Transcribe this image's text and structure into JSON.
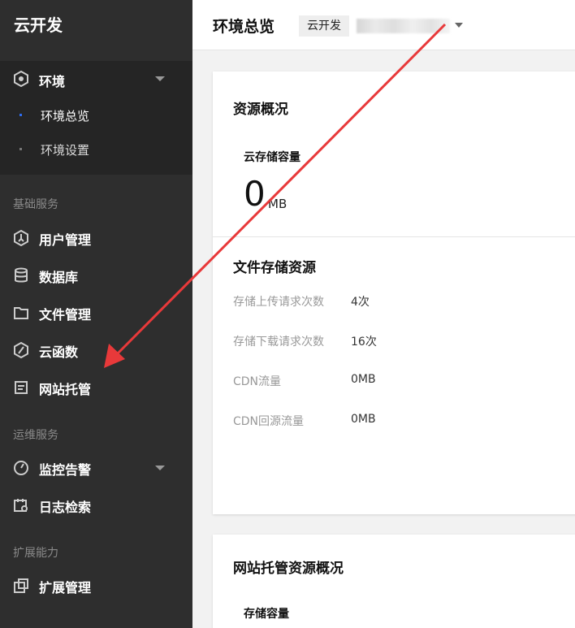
{
  "brand": "云开发",
  "sidebar": {
    "env_group": {
      "label": "环境",
      "items": [
        {
          "label": "环境总览",
          "active": true
        },
        {
          "label": "环境设置",
          "active": false
        }
      ]
    },
    "sections": [
      {
        "title": "基础服务",
        "items": [
          "用户管理",
          "数据库",
          "文件管理",
          "云函数",
          "网站托管"
        ]
      },
      {
        "title": "运维服务",
        "items": [
          "监控告警",
          "日志检索"
        ]
      },
      {
        "title": "扩展能力",
        "items": [
          "扩展管理"
        ]
      }
    ]
  },
  "header": {
    "title": "环境总览",
    "env_tag": "云开发",
    "env_id": "c..."
  },
  "overview": {
    "title": "资源概况",
    "storage_label": "云存储容量",
    "storage_value": "0",
    "storage_unit": "MB",
    "file_title": "文件存储资源",
    "rows": [
      {
        "k": "存储上传请求次数",
        "v": "4次"
      },
      {
        "k": "存储下载请求次数",
        "v": "16次"
      },
      {
        "k": "CDN流量",
        "v": "0MB"
      },
      {
        "k": "CDN回源流量",
        "v": "0MB"
      }
    ]
  },
  "hosting": {
    "title": "网站托管资源概况",
    "storage_label": "存储容量"
  },
  "colors": {
    "sidebar": "#2e2e2e",
    "active_dot": "#2d6cf0",
    "arrow": "#e8393a"
  }
}
